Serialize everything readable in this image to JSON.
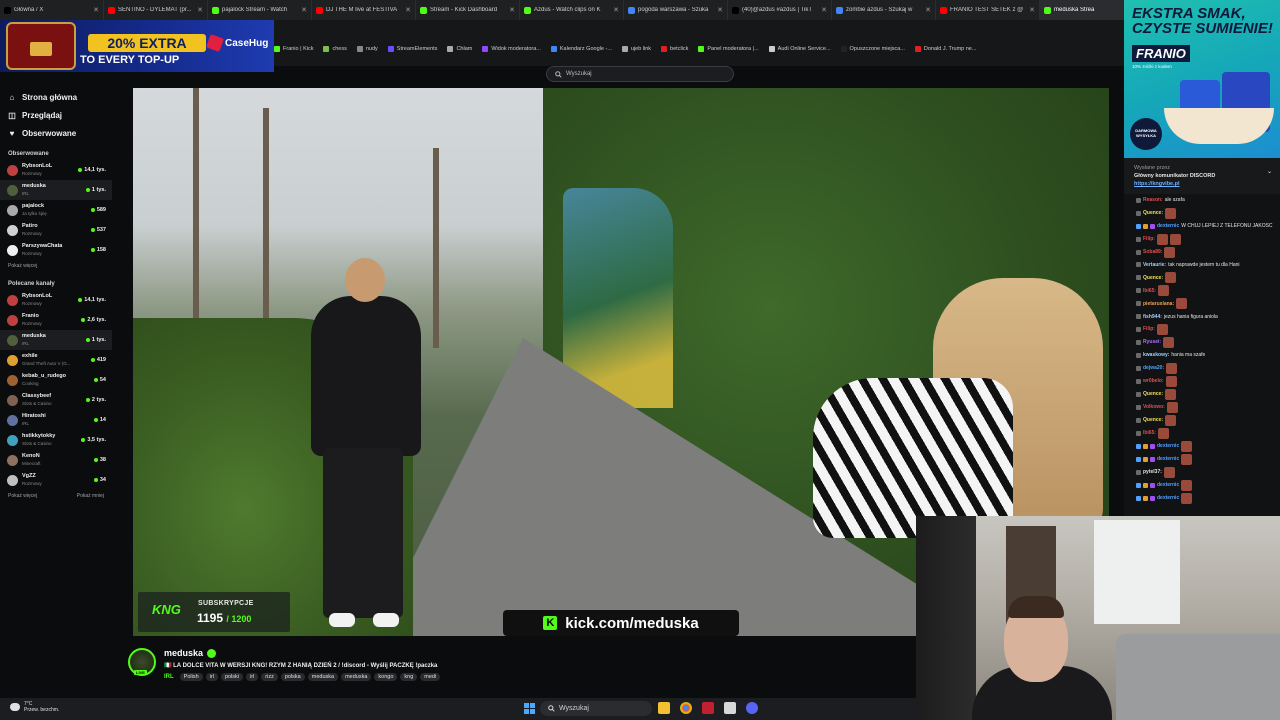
{
  "browser": {
    "tabs": [
      {
        "label": "Główna / X",
        "color": "#000000",
        "active": false
      },
      {
        "label": "SENTINO - DYLEMAT (pr...",
        "color": "#ff0000",
        "active": false
      },
      {
        "label": "pajalock Stream - Watch",
        "color": "#53fc18",
        "active": false
      },
      {
        "label": "DJ THE M live at FESTIVA",
        "color": "#ff0000",
        "active": false
      },
      {
        "label": "Stream - Kick Dashboard",
        "color": "#53fc18",
        "active": false
      },
      {
        "label": "Azdus - Watch clips on K",
        "color": "#53fc18",
        "active": false
      },
      {
        "label": "pogoda warszawa - Szuka",
        "color": "#4285f4",
        "active": false
      },
      {
        "label": "(40)@azdus #azdus | TikT",
        "color": "#000000",
        "active": false
      },
      {
        "label": "zombie azdus - Szukaj w",
        "color": "#4285f4",
        "active": false
      },
      {
        "label": "FRANIO TEST SETEK z @",
        "color": "#ff0000",
        "active": false
      },
      {
        "label": "meduska Strea",
        "color": "#53fc18",
        "active": true
      }
    ],
    "bookmarks": [
      {
        "label": "Franio | Kick",
        "color": "#53fc18"
      },
      {
        "label": "chess",
        "color": "#7cbf4a"
      },
      {
        "label": "nudy",
        "color": "#888888"
      },
      {
        "label": "StreamElements",
        "color": "#6d4cff"
      },
      {
        "label": "Chłam",
        "color": "#aaaaaa"
      },
      {
        "label": "Widok moderatora...",
        "color": "#9146ff"
      },
      {
        "label": "Kalendarz Google -...",
        "color": "#4285f4"
      },
      {
        "label": "ujeb link",
        "color": "#aaaaaa"
      },
      {
        "label": "betclick",
        "color": "#e02020"
      },
      {
        "label": "Panel moderatora |...",
        "color": "#53fc18"
      },
      {
        "label": "Audi Online Service...",
        "color": "#cccccc"
      },
      {
        "label": "Opuszczone miejsca...",
        "color": "#222222"
      },
      {
        "label": "Donald J. Trump ne...",
        "color": "#e02020"
      }
    ]
  },
  "ad_left": {
    "promo": "20% EXTRA",
    "promo2": "TO EVERY TOP-UP",
    "brand": "CaseHug"
  },
  "search": {
    "placeholder": "Wyszukaj"
  },
  "sidebar": {
    "nav": [
      {
        "label": "Strona główna",
        "icon": "home-icon"
      },
      {
        "label": "Przeglądaj",
        "icon": "browse-icon"
      },
      {
        "label": "Obserwowane",
        "icon": "heart-icon"
      }
    ],
    "followed_title": "Obserwowane",
    "followed": [
      {
        "name": "RybsonLoL",
        "cat": "Rozmowy",
        "viewers": "14,1 tys.",
        "color": "#c04040"
      },
      {
        "name": "meduska",
        "cat": "IRL",
        "viewers": "1 tys.",
        "color": "#50603a",
        "selected": true
      },
      {
        "name": "pajalock",
        "cat": "Ja tylko śpię",
        "viewers": "589",
        "color": "#aaaaaa"
      },
      {
        "name": "Patiro",
        "cat": "Rozmowy",
        "viewers": "537",
        "color": "#d0d0d0"
      },
      {
        "name": "ParszywaChata",
        "cat": "Rozmowy",
        "viewers": "158",
        "color": "#f0f0f0"
      }
    ],
    "followed_more": "Pokaż więcej",
    "recommended_title": "Polecane kanały",
    "recommended": [
      {
        "name": "RybsonLoL",
        "cat": "Rozmowy",
        "viewers": "14,1 tys.",
        "color": "#c04040"
      },
      {
        "name": "Franio",
        "cat": "Rozmowy",
        "viewers": "2,6 tys.",
        "color": "#c04040"
      },
      {
        "name": "meduska",
        "cat": "IRL",
        "viewers": "1 tys.",
        "color": "#50603a",
        "selected": true
      },
      {
        "name": "exhile",
        "cat": "Grand Theft Auto V (G...",
        "viewers": "419",
        "color": "#e0a030"
      },
      {
        "name": "kebab_u_rudego",
        "cat": "Cooking",
        "viewers": "54",
        "color": "#a06030"
      },
      {
        "name": "Classybeef",
        "cat": "Slots & Casino",
        "viewers": "2 tys.",
        "color": "#806050"
      },
      {
        "name": "Hiratoshi",
        "cat": "IRL",
        "viewers": "14",
        "color": "#6070a0"
      },
      {
        "name": "hstikkytokky",
        "cat": "Slots & Casino",
        "viewers": "3,5 tys.",
        "color": "#40a0c0"
      },
      {
        "name": "KenoN",
        "cat": "Minecraft",
        "viewers": "38",
        "color": "#907060"
      },
      {
        "name": "VgZZ",
        "cat": "Rozmowy",
        "viewers": "34",
        "color": "#c0c0c0"
      }
    ],
    "more_left": "Pokaż więcej",
    "more_right": "Pokaż mniej"
  },
  "video": {
    "sub_label": "SUBSKRYPCJE",
    "sub_count": "1195",
    "sub_goal": "/ 1200",
    "kng": "KNG",
    "url": "kick.com/meduska"
  },
  "stream": {
    "name": "meduska",
    "live": "LIVE",
    "title": "🇮🇹 LA DOLCE VITA W WERSJI KNG! RZYM Z HANIĄ DZIEŃ 2 / !discord - Wyślij PACZKĘ !paczka",
    "category": "IRL",
    "tags": [
      "Polish",
      "irl",
      "polski",
      "irl",
      "rizz",
      "polska",
      "meduska",
      "meduska",
      "kongo",
      "kng",
      "medi"
    ]
  },
  "ad_right": {
    "headline1": "EKSTRA SMAK,",
    "headline2": "CZYSTE SUMIENIE!",
    "brand": "FRANIO",
    "small": "10% zniżki z kodem",
    "stamp": "DARMOWA WYSYŁKA"
  },
  "chat": {
    "pinned_by": "Wysłane przez",
    "pinned_text": "Główny komunikator DISCORD",
    "pinned_link": "https://kngvibe.pl",
    "messages": [
      {
        "user": "Reason:",
        "color": "#e05050",
        "text": "ale szafa",
        "emotes": 0
      },
      {
        "user": "Quence:",
        "color": "#f0e050",
        "text": "",
        "emotes": 1
      },
      {
        "user": "dexternic",
        "color": "#50a0ff",
        "text": "W CHUJ LEPIEJ Z TELEFONU JAKOSC",
        "emotes": 0
      },
      {
        "user": "Filip:",
        "color": "#e05050",
        "text": "",
        "emotes": 2
      },
      {
        "user": "Soba89:",
        "color": "#e05050",
        "text": "",
        "emotes": 1
      },
      {
        "user": "Vertaurie:",
        "color": "#a0d0ff",
        "text": "tak naprawde jestem tu dla Hani",
        "emotes": 0
      },
      {
        "user": "Quence:",
        "color": "#f0e050",
        "text": "",
        "emotes": 1
      },
      {
        "user": "lbi65:",
        "color": "#e05050",
        "text": "",
        "emotes": 1
      },
      {
        "user": "pietaruslana:",
        "color": "#f0a050",
        "text": "",
        "emotes": 1
      },
      {
        "user": "fish944:",
        "color": "#a0d0ff",
        "text": "jezus hania figura aniola",
        "emotes": 0
      },
      {
        "user": "Filip:",
        "color": "#e05050",
        "text": "",
        "emotes": 1
      },
      {
        "user": "Ryusei:",
        "color": "#b070ff",
        "text": "",
        "emotes": 1
      },
      {
        "user": "kwaskowy:",
        "color": "#a0d0ff",
        "text": "hania ma szafe",
        "emotes": 0
      },
      {
        "user": "dejwa20:",
        "color": "#50a0ff",
        "text": "",
        "emotes": 1
      },
      {
        "user": "wr0belo:",
        "color": "#e05050",
        "text": "",
        "emotes": 1
      },
      {
        "user": "Quence:",
        "color": "#f0e050",
        "text": "",
        "emotes": 1
      },
      {
        "user": "Volkowo:",
        "color": "#e05050",
        "text": "",
        "emotes": 1
      },
      {
        "user": "Quence:",
        "color": "#f0e050",
        "text": "",
        "emotes": 1
      },
      {
        "user": "lbi65:",
        "color": "#e05050",
        "text": "",
        "emotes": 1
      },
      {
        "user": "dexternic",
        "color": "#50a0ff",
        "text": "",
        "emotes": 1
      },
      {
        "user": "dexternic",
        "color": "#50a0ff",
        "text": "",
        "emotes": 1
      },
      {
        "user": "pytel37:",
        "color": "#e0e0e0",
        "text": "",
        "emotes": 1
      },
      {
        "user": "dexternic",
        "color": "#50a0ff",
        "text": "",
        "emotes": 1
      },
      {
        "user": "dexternic",
        "color": "#50a0ff",
        "text": "",
        "emotes": 1
      }
    ]
  },
  "taskbar": {
    "temp": "7°C",
    "weather": "Przew. bezchm.",
    "search": "Wyszukaj"
  }
}
